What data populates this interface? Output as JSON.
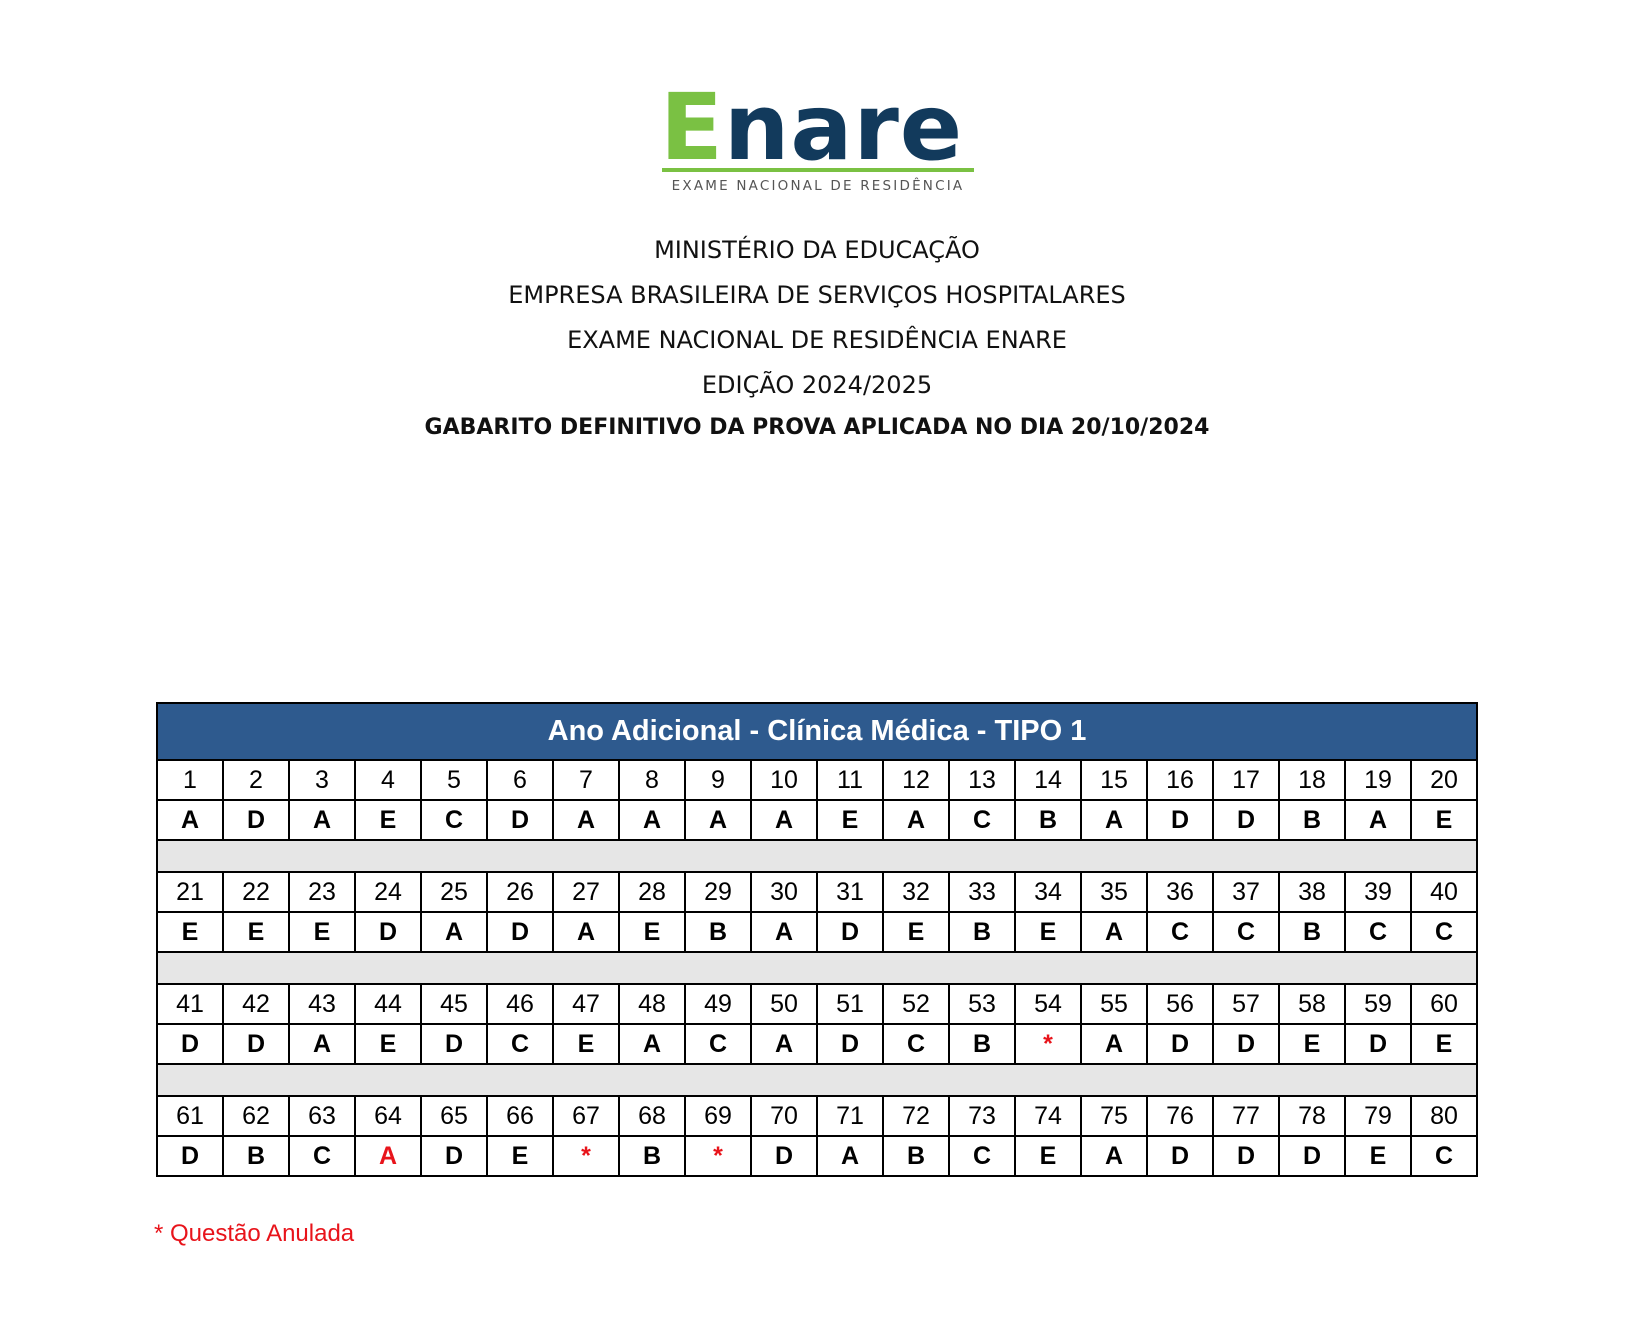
{
  "logo": {
    "word_first": "E",
    "word_rest": "nare",
    "tagline": "EXAME NACIONAL DE RESIDÊNCIA",
    "colors": {
      "green": "#7ac143",
      "navy": "#123a5c"
    }
  },
  "header": {
    "line1": "MINISTÉRIO DA EDUCAÇÃO",
    "line2": "EMPRESA BRASILEIRA DE SERVIÇOS HOSPITALARES",
    "line3": "EXAME NACIONAL DE RESIDÊNCIA ENARE",
    "line4": "EDIÇÃO 2024/2025",
    "line5": "GABARITO DEFINITIVO DA PROVA APLICADA NO DIA 20/10/2024"
  },
  "table": {
    "title": "Ano Adicional - Clínica Médica - TIPO  1",
    "header_color": "#2e5a8e",
    "blocks": [
      {
        "numbers": [
          "1",
          "2",
          "3",
          "4",
          "5",
          "6",
          "7",
          "8",
          "9",
          "10",
          "11",
          "12",
          "13",
          "14",
          "15",
          "16",
          "17",
          "18",
          "19",
          "20"
        ],
        "answers": [
          "A",
          "D",
          "A",
          "E",
          "C",
          "D",
          "A",
          "A",
          "A",
          "A",
          "E",
          "A",
          "C",
          "B",
          "A",
          "D",
          "D",
          "B",
          "A",
          "E"
        ],
        "red": []
      },
      {
        "numbers": [
          "21",
          "22",
          "23",
          "24",
          "25",
          "26",
          "27",
          "28",
          "29",
          "30",
          "31",
          "32",
          "33",
          "34",
          "35",
          "36",
          "37",
          "38",
          "39",
          "40"
        ],
        "answers": [
          "E",
          "E",
          "E",
          "D",
          "A",
          "D",
          "A",
          "E",
          "B",
          "A",
          "D",
          "E",
          "B",
          "E",
          "A",
          "C",
          "C",
          "B",
          "C",
          "C"
        ],
        "red": []
      },
      {
        "numbers": [
          "41",
          "42",
          "43",
          "44",
          "45",
          "46",
          "47",
          "48",
          "49",
          "50",
          "51",
          "52",
          "53",
          "54",
          "55",
          "56",
          "57",
          "58",
          "59",
          "60"
        ],
        "answers": [
          "D",
          "D",
          "A",
          "E",
          "D",
          "C",
          "E",
          "A",
          "C",
          "A",
          "D",
          "C",
          "B",
          "*",
          "A",
          "D",
          "D",
          "E",
          "D",
          "E"
        ],
        "red": [
          13
        ]
      },
      {
        "numbers": [
          "61",
          "62",
          "63",
          "64",
          "65",
          "66",
          "67",
          "68",
          "69",
          "70",
          "71",
          "72",
          "73",
          "74",
          "75",
          "76",
          "77",
          "78",
          "79",
          "80"
        ],
        "answers": [
          "D",
          "B",
          "C",
          "A",
          "D",
          "E",
          "*",
          "B",
          "*",
          "D",
          "A",
          "B",
          "C",
          "E",
          "A",
          "D",
          "D",
          "D",
          "E",
          "C"
        ],
        "red": [
          3,
          6,
          8
        ]
      }
    ]
  },
  "footnote": "* Questão Anulada",
  "accent_red": "#e8141b"
}
